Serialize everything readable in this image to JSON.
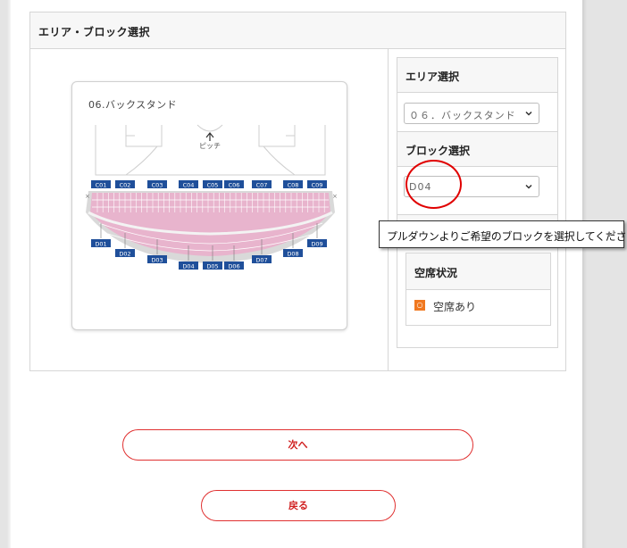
{
  "panel": {
    "title": "エリア・ブロック選択"
  },
  "map": {
    "title": "06.バックスタンド",
    "pitch_label": "ピッチ",
    "upper_blocks": [
      "C01",
      "C02",
      "C03",
      "C04",
      "C05",
      "C06",
      "C07",
      "C08",
      "C09"
    ],
    "lower_blocks": [
      "D01",
      "D02",
      "D03",
      "D04",
      "D05",
      "D06",
      "D07",
      "D08",
      "D09"
    ]
  },
  "area": {
    "heading": "エリア選択",
    "selected": "０６．バックスタンド"
  },
  "block": {
    "heading": "ブロック選択",
    "selected": "D04"
  },
  "status": {
    "heading": "空席状況",
    "legend_mark": "○",
    "legend_text": "空席あり"
  },
  "tooltip": {
    "text": "プルダウンよりご希望のブロックを選択してください"
  },
  "buttons": {
    "next": "次へ",
    "back": "戻る"
  },
  "colors": {
    "accent": "#e03030",
    "block_badge": "#1f4f9a",
    "seat_fill": "#e8b4cd",
    "available": "#f07820"
  }
}
